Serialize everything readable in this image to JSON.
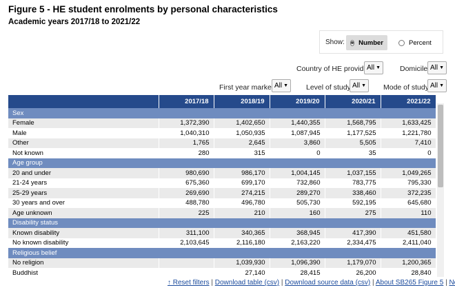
{
  "title": "Figure 5 - HE student enrolments by personal characteristics",
  "subtitle": "Academic years 2017/18 to 2021/22",
  "show": {
    "label": "Show:",
    "option_number": "Number",
    "option_percent": "Percent",
    "selected": "Number"
  },
  "filters": {
    "country_label": "Country of HE provider",
    "country_value": "All",
    "domicile_label": "Domicile",
    "domicile_value": "All",
    "first_year_label": "First year marker",
    "first_year_value": "All",
    "level_label": "Level of study",
    "level_value": "All",
    "mode_label": "Mode of study",
    "mode_value": "All"
  },
  "table": {
    "columns": [
      "",
      "2017/18",
      "2018/19",
      "2019/20",
      "2020/21",
      "2021/22"
    ],
    "rows": [
      {
        "type": "group",
        "label": "Sex"
      },
      {
        "type": "data",
        "label": "Female",
        "values": [
          "1,372,390",
          "1,402,650",
          "1,440,355",
          "1,568,795",
          "1,633,425"
        ]
      },
      {
        "type": "data",
        "label": "Male",
        "values": [
          "1,040,310",
          "1,050,935",
          "1,087,945",
          "1,177,525",
          "1,221,780"
        ]
      },
      {
        "type": "data",
        "label": "Other",
        "values": [
          "1,765",
          "2,645",
          "3,860",
          "5,505",
          "7,410"
        ]
      },
      {
        "type": "data",
        "label": "Not known",
        "values": [
          "280",
          "315",
          "0",
          "35",
          "0"
        ]
      },
      {
        "type": "group",
        "label": "Age group"
      },
      {
        "type": "data",
        "label": "20 and under",
        "values": [
          "980,690",
          "986,170",
          "1,004,145",
          "1,037,155",
          "1,049,265"
        ]
      },
      {
        "type": "data",
        "label": "21-24 years",
        "values": [
          "675,360",
          "699,170",
          "732,860",
          "783,775",
          "795,330"
        ]
      },
      {
        "type": "data",
        "label": "25-29 years",
        "values": [
          "269,690",
          "274,215",
          "289,270",
          "338,460",
          "372,235"
        ]
      },
      {
        "type": "data",
        "label": "30 years and over",
        "values": [
          "488,780",
          "496,780",
          "505,730",
          "592,195",
          "645,680"
        ]
      },
      {
        "type": "data",
        "label": "Age unknown",
        "values": [
          "225",
          "210",
          "160",
          "275",
          "110"
        ]
      },
      {
        "type": "group",
        "label": "Disability status"
      },
      {
        "type": "data",
        "label": "Known disability",
        "values": [
          "311,100",
          "340,365",
          "368,945",
          "417,390",
          "451,580"
        ]
      },
      {
        "type": "data",
        "label": "No known disability",
        "values": [
          "2,103,645",
          "2,116,180",
          "2,163,220",
          "2,334,475",
          "2,411,040"
        ]
      },
      {
        "type": "group",
        "label": "Religious belief"
      },
      {
        "type": "data",
        "label": "No religion",
        "values": [
          "",
          "1,039,930",
          "1,096,390",
          "1,179,070",
          "1,200,365"
        ]
      },
      {
        "type": "data",
        "label": "Buddhist",
        "values": [
          "",
          "27,140",
          "28,415",
          "26,200",
          "28,840"
        ]
      }
    ]
  },
  "links": {
    "reset": "↑ Reset filters",
    "download_csv": "Download table (csv)",
    "download_source": "Download source data (csv)",
    "about": "About SB265 Figure 5",
    "notes": "Notes"
  },
  "colors": {
    "header": "#254a8b",
    "group": "#6f8cbf",
    "stripe": "#eaeaea",
    "link": "#1a4a9c"
  }
}
